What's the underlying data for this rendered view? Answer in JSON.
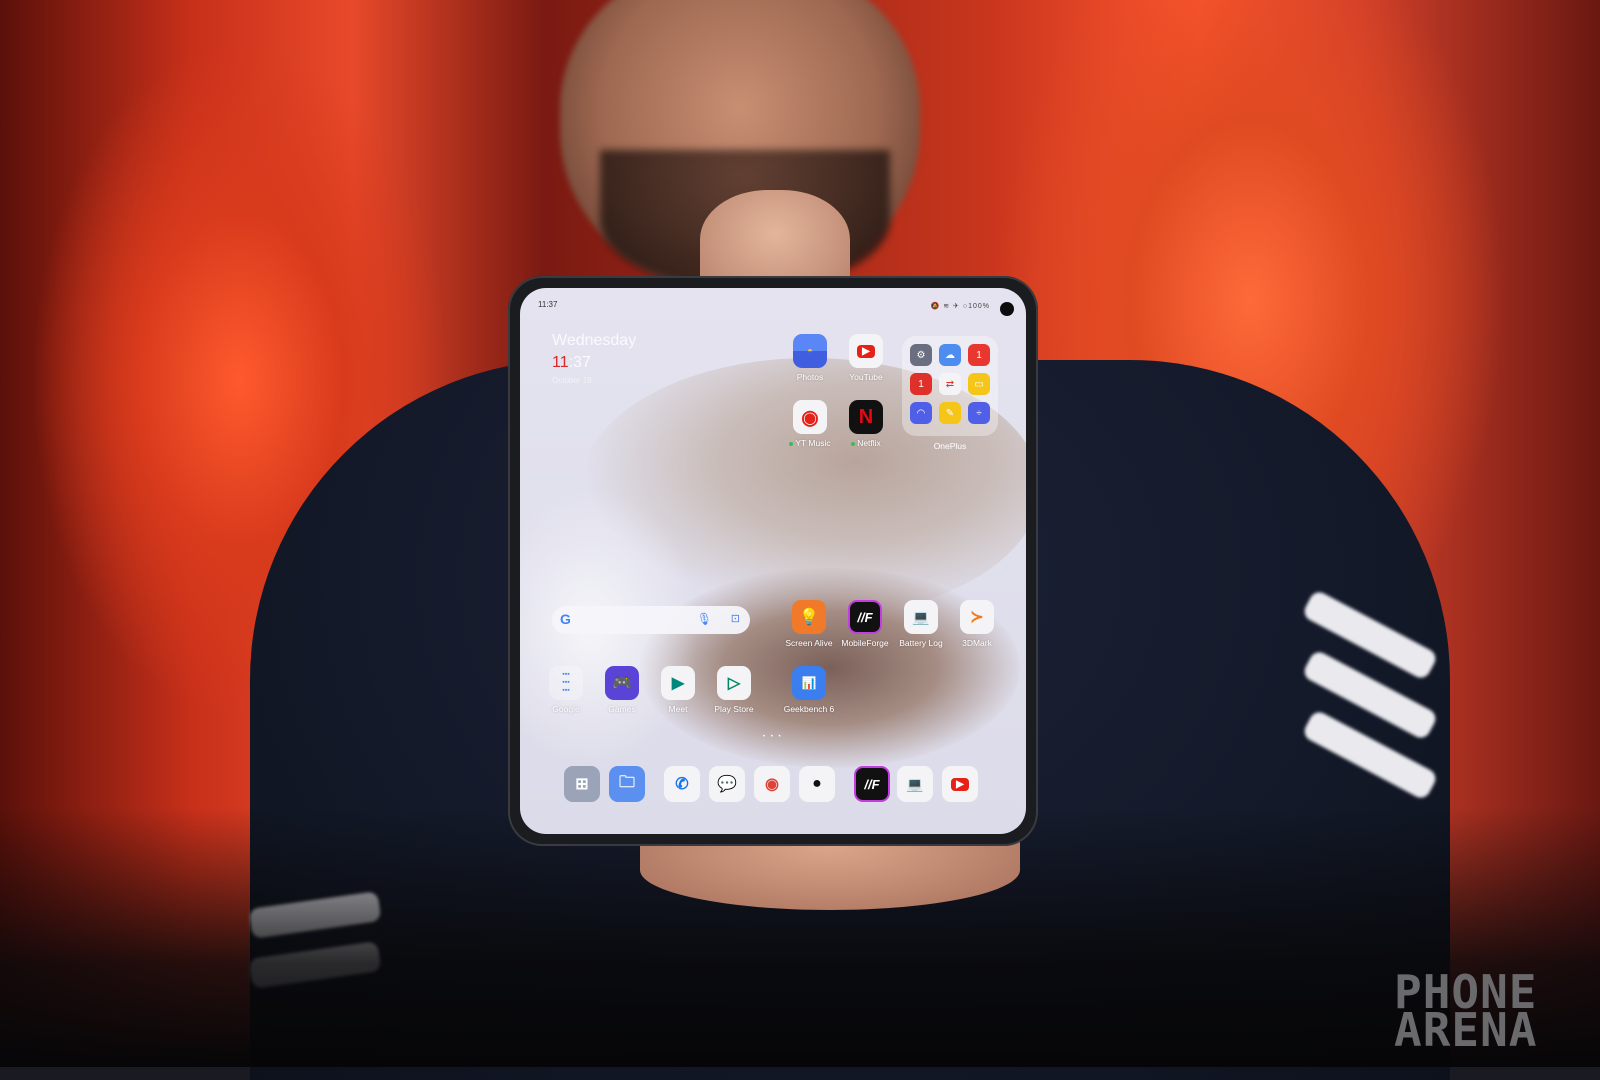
{
  "status_bar": {
    "time": "11:37",
    "icons": [
      "mute-icon",
      "wifi-icon",
      "airplane-icon",
      "battery-ring-icon"
    ],
    "battery": "100%"
  },
  "clock_widget": {
    "day": "Wednesday",
    "hour": "11",
    "minute": ":37",
    "date": "October 18"
  },
  "apps_top": [
    {
      "name": "Photos",
      "color": "#4a6cf0",
      "dot": false
    },
    {
      "name": "YouTube",
      "color": "#f4f4f7",
      "dot": false
    },
    {
      "name": "YT Music",
      "color": "#f4f4f7",
      "dot": true
    },
    {
      "name": "Netflix",
      "color": "#111111",
      "dot": true
    }
  ],
  "folder": {
    "label": "OnePlus",
    "apps": [
      "Settings",
      "Weather",
      "OnePlus Store",
      "Notes Red",
      "Clone Phone",
      "File Manager",
      "Remote",
      "Notes",
      "Calculator"
    ]
  },
  "search_bar": {
    "logo": "G",
    "mic_icon": "mic-icon",
    "lens_icon": "lens-icon"
  },
  "apps_middle": [
    {
      "name": "Screen Alive",
      "color": "#f07a2a"
    },
    {
      "name": "MobileForge",
      "color": "#111111"
    },
    {
      "name": "Battery Log",
      "color": "#f4f4f7"
    },
    {
      "name": "3DMark",
      "color": "#f4f4f7"
    }
  ],
  "apps_bottom": [
    {
      "name": "Google",
      "color": "transparent"
    },
    {
      "name": "Games",
      "color": "#5a44d8"
    },
    {
      "name": "Meet",
      "color": "#f4f4f7"
    },
    {
      "name": "Play Store",
      "color": "#f4f4f7"
    },
    {
      "name": "Geekbench 6",
      "color": "#3a7ef0"
    }
  ],
  "pager": "• • •",
  "dock": [
    {
      "name": "App Drawer",
      "color": "#9aa3b8"
    },
    {
      "name": "Files",
      "color": "#5b8ff0"
    },
    {
      "name": "Phone",
      "color": "#f4f4f7"
    },
    {
      "name": "Messages",
      "color": "#f4f4f7"
    },
    {
      "name": "Chrome",
      "color": "#f4f4f7"
    },
    {
      "name": "Camera",
      "color": "#f4f4f7"
    },
    {
      "name": "MobileForge",
      "color": "#111111"
    },
    {
      "name": "Battery Log",
      "color": "#f4f4f7"
    },
    {
      "name": "YouTube",
      "color": "#f4f4f7"
    }
  ],
  "watermark": {
    "line1": "PHONE",
    "line2": "ARENA"
  }
}
